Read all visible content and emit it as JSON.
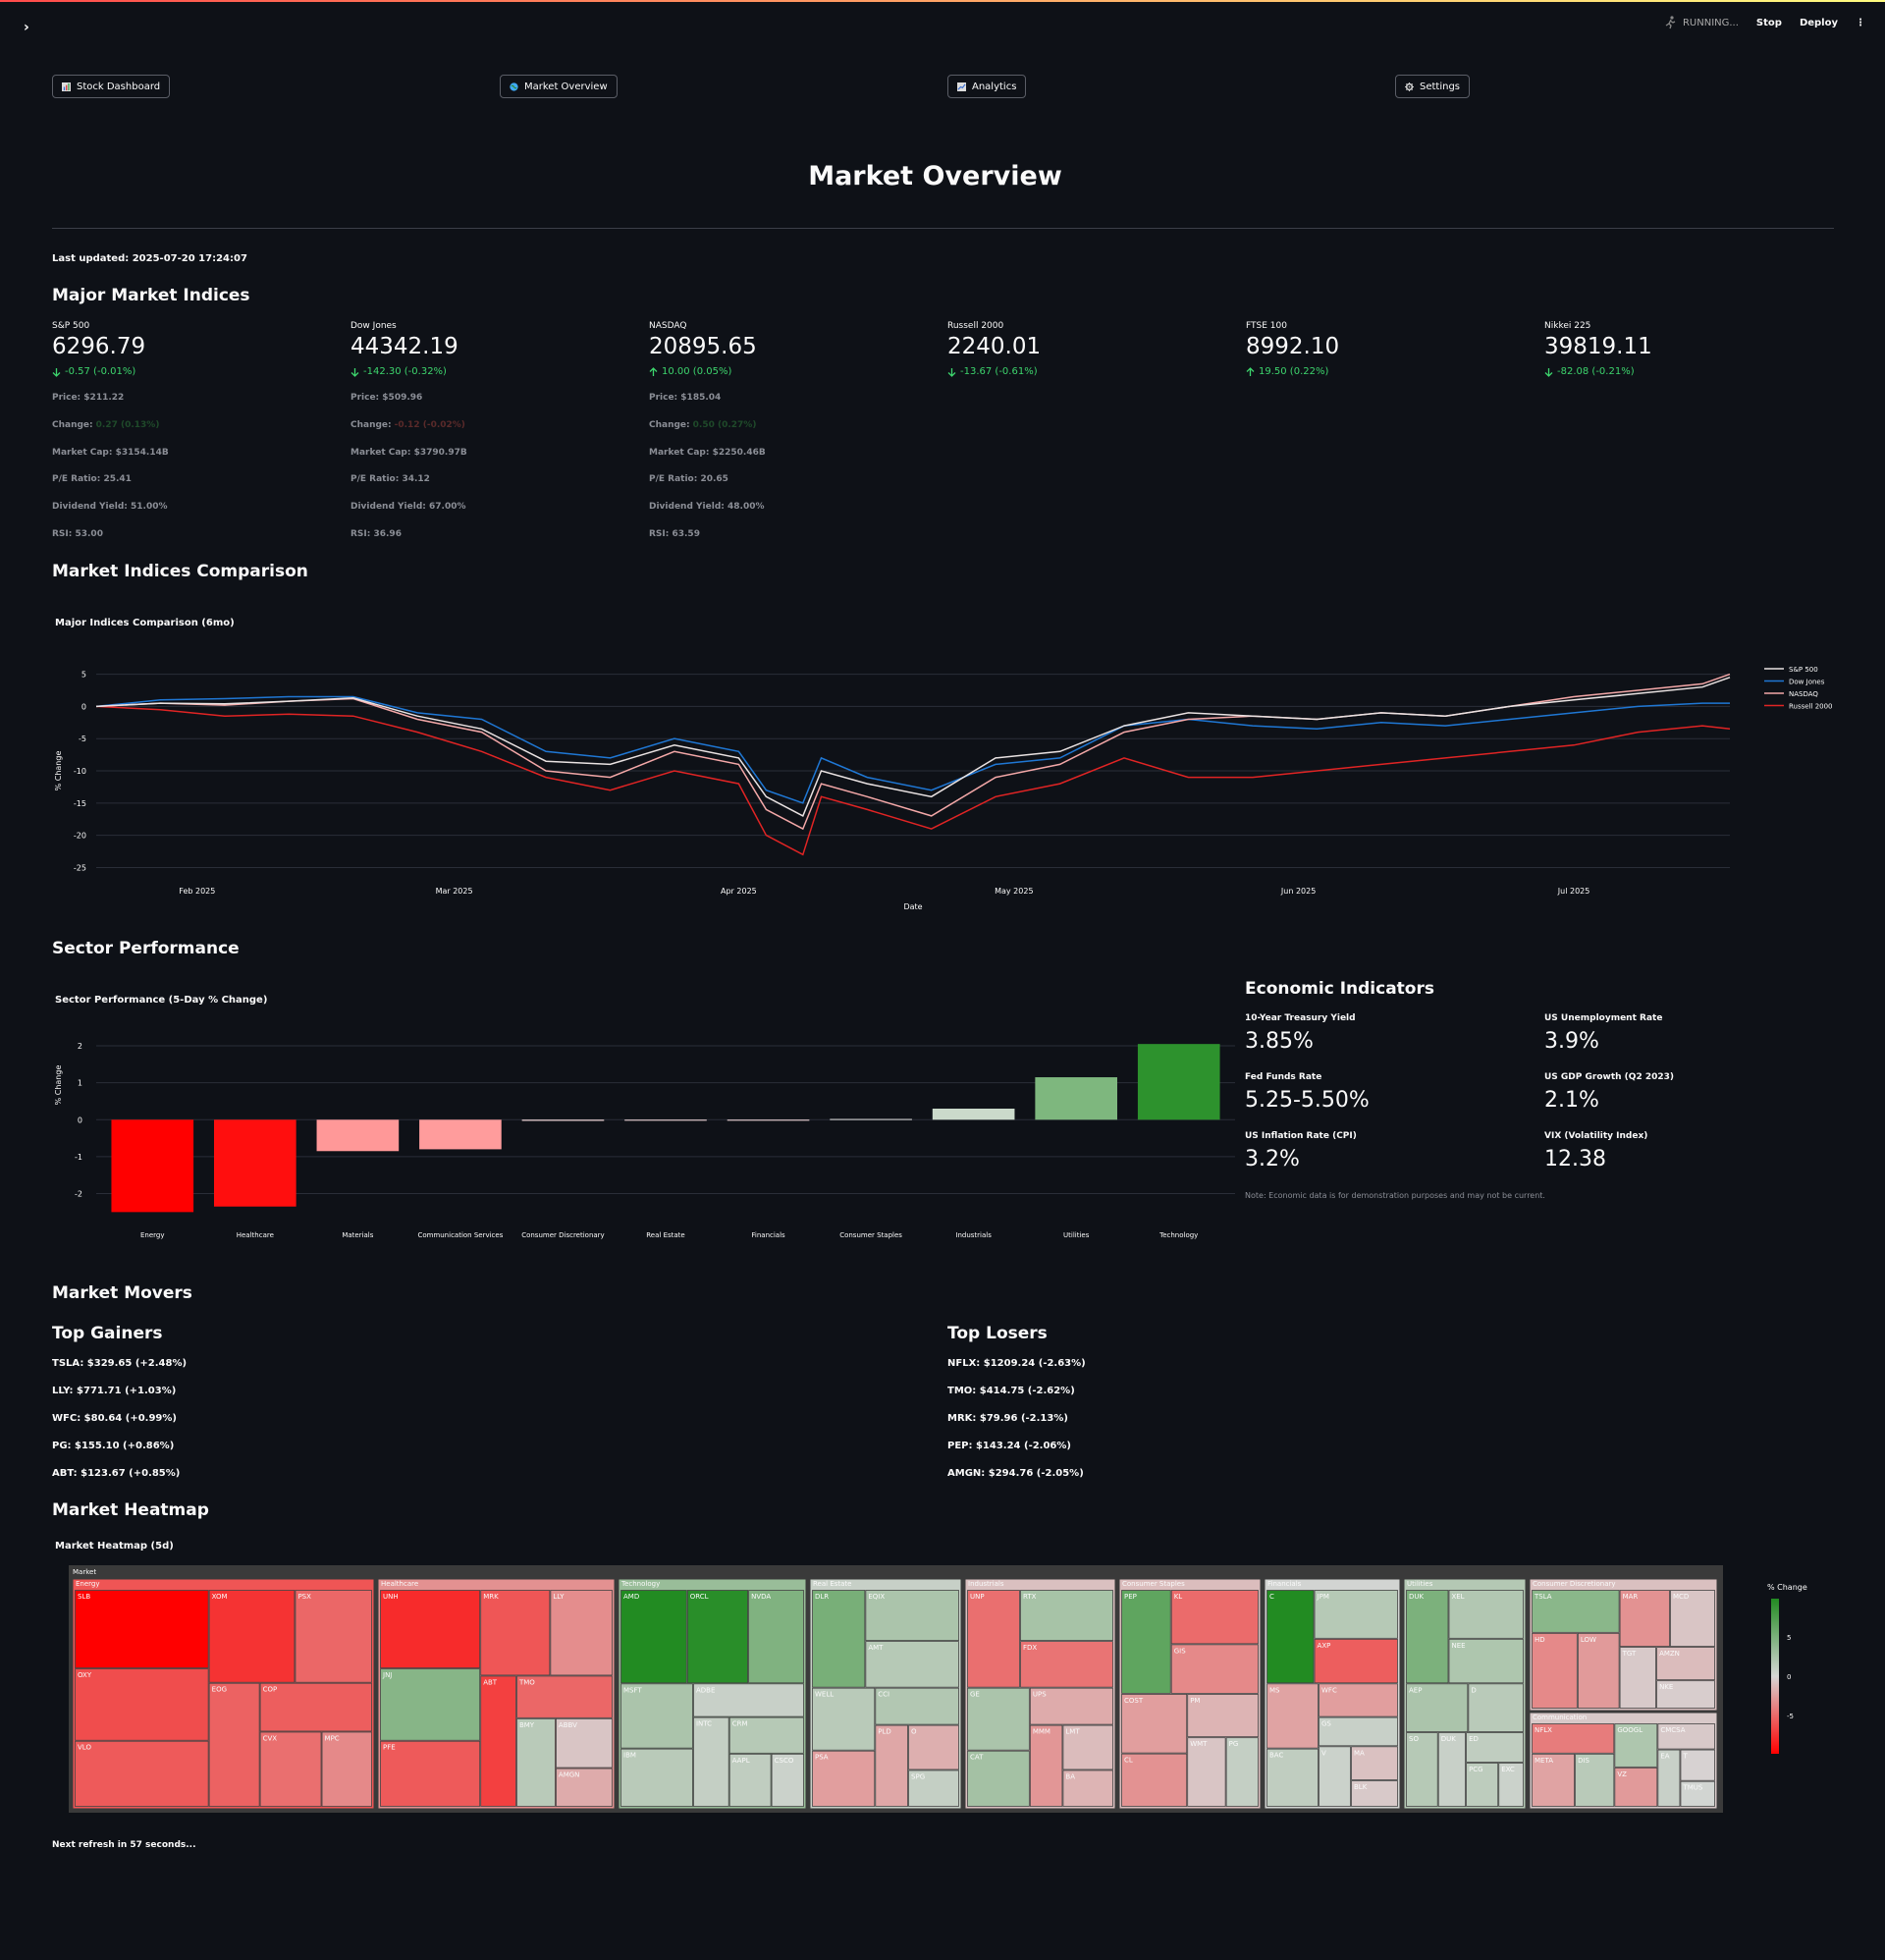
{
  "app": {
    "status": "RUNNING...",
    "stop_label": "Stop",
    "deploy_label": "Deploy",
    "sidebar_toggle": "›",
    "menu_icon": "⋮"
  },
  "nav": {
    "items": [
      {
        "label": "Stock Dashboard",
        "icon": "chart-icon"
      },
      {
        "label": "Market Overview",
        "icon": "globe-icon"
      },
      {
        "label": "Analytics",
        "icon": "trend-icon"
      },
      {
        "label": "Settings",
        "icon": "gear-icon"
      }
    ]
  },
  "page": {
    "title": "Market Overview",
    "last_updated": "Last updated: 2025-07-20 17:24:07",
    "refresh_note": "Next refresh in 57 seconds..."
  },
  "indices": {
    "heading": "Major Market Indices",
    "items": [
      {
        "name": "S&P 500",
        "value": "6296.79",
        "delta": "-0.57 (-0.01%)",
        "direction": "down",
        "price": "Price: $211.22",
        "change_label": "Change:",
        "change": "0.27 (0.13%)",
        "change_color": "green",
        "market_cap": "Market Cap: $3154.14B",
        "pe": "P/E Ratio: 25.41",
        "div": "Dividend Yield: 51.00%",
        "rsi": "RSI: 53.00"
      },
      {
        "name": "Dow Jones",
        "value": "44342.19",
        "delta": "-142.30 (-0.32%)",
        "direction": "down",
        "price": "Price: $509.96",
        "change_label": "Change:",
        "change": "-0.12 (-0.02%)",
        "change_color": "red",
        "market_cap": "Market Cap: $3790.97B",
        "pe": "P/E Ratio: 34.12",
        "div": "Dividend Yield: 67.00%",
        "rsi": "RSI: 36.96"
      },
      {
        "name": "NASDAQ",
        "value": "20895.65",
        "delta": "10.00 (0.05%)",
        "direction": "up",
        "price": "Price: $185.04",
        "change_label": "Change:",
        "change": "0.50 (0.27%)",
        "change_color": "green",
        "market_cap": "Market Cap: $2250.46B",
        "pe": "P/E Ratio: 20.65",
        "div": "Dividend Yield: 48.00%",
        "rsi": "RSI: 63.59"
      },
      {
        "name": "Russell 2000",
        "value": "2240.01",
        "delta": "-13.67 (-0.61%)",
        "direction": "down"
      },
      {
        "name": "FTSE 100",
        "value": "8992.10",
        "delta": "19.50 (0.22%)",
        "direction": "up"
      },
      {
        "name": "Nikkei 225",
        "value": "39819.11",
        "delta": "-82.08 (-0.21%)",
        "direction": "down"
      }
    ]
  },
  "comparison": {
    "heading": "Market Indices Comparison",
    "chart_title": "Major Indices Comparison (6mo)"
  },
  "sector": {
    "heading": "Sector Performance",
    "chart_title": "Sector Performance (5-Day % Change)"
  },
  "economic": {
    "heading": "Economic Indicators",
    "items": [
      {
        "label": "10-Year Treasury Yield",
        "value": "3.85%"
      },
      {
        "label": "US Unemployment Rate",
        "value": "3.9%"
      },
      {
        "label": "Fed Funds Rate",
        "value": "5.25-5.50%"
      },
      {
        "label": "US GDP Growth (Q2 2023)",
        "value": "2.1%"
      },
      {
        "label": "US Inflation Rate (CPI)",
        "value": "3.2%"
      },
      {
        "label": "VIX (Volatility Index)",
        "value": "12.38"
      }
    ],
    "note": "Note: Economic data is for demonstration purposes and may not be current."
  },
  "movers": {
    "heading": "Market Movers",
    "gainers_heading": "Top Gainers",
    "losers_heading": "Top Losers",
    "gainers": [
      "TSLA: $329.65 (+2.48%)",
      "LLY: $771.71 (+1.03%)",
      "WFC: $80.64 (+0.99%)",
      "PG: $155.10 (+0.86%)",
      "ABT: $123.67 (+0.85%)"
    ],
    "losers": [
      "NFLX: $1209.24 (-2.63%)",
      "TMO: $414.75 (-2.62%)",
      "MRK: $79.96 (-2.13%)",
      "PEP: $143.24 (-2.06%)",
      "AMGN: $294.76 (-2.05%)"
    ]
  },
  "heatmap": {
    "heading": "Market Heatmap",
    "chart_title": "Market Heatmap (5d)",
    "root_label": "Market",
    "colorbar_title": "% Change",
    "colorbar_ticks": [
      "5",
      "0",
      "-5"
    ]
  },
  "chart_data": [
    {
      "type": "line",
      "title": "Major Indices Comparison (6mo)",
      "xlabel": "Date",
      "ylabel": "% Change",
      "x_ticks": [
        "Feb 2025",
        "Mar 2025",
        "Apr 2025",
        "May 2025",
        "Jun 2025",
        "Jul 2025"
      ],
      "y_ticks": [
        5,
        0,
        -5,
        -10,
        -15,
        -20,
        -25
      ],
      "ylim": [
        -26,
        6
      ],
      "x": [
        "2025-01-21",
        "2025-01-28",
        "2025-02-04",
        "2025-02-11",
        "2025-02-18",
        "2025-02-25",
        "2025-03-04",
        "2025-03-11",
        "2025-03-18",
        "2025-03-25",
        "2025-04-01",
        "2025-04-04",
        "2025-04-08",
        "2025-04-10",
        "2025-04-15",
        "2025-04-22",
        "2025-04-29",
        "2025-05-06",
        "2025-05-13",
        "2025-05-20",
        "2025-05-27",
        "2025-06-03",
        "2025-06-10",
        "2025-06-17",
        "2025-06-24",
        "2025-07-01",
        "2025-07-08",
        "2025-07-15",
        "2025-07-18"
      ],
      "series": [
        {
          "name": "S&P 500",
          "color": "#e9e2e2",
          "values": [
            0,
            0.5,
            0.4,
            0.8,
            1.3,
            -1.5,
            -3.5,
            -8.5,
            -9,
            -6,
            -8,
            -14,
            -17,
            -10,
            -12,
            -14,
            -8,
            -7,
            -3,
            -1,
            -1.5,
            -2,
            -1,
            -1.5,
            0,
            1,
            2,
            3,
            4.5
          ]
        },
        {
          "name": "Dow Jones",
          "color": "#1f77d4",
          "values": [
            0,
            1,
            1.2,
            1.5,
            1.5,
            -1,
            -2,
            -7,
            -8,
            -5,
            -7,
            -13,
            -15,
            -8,
            -11,
            -13,
            -9,
            -8,
            -3,
            -2,
            -3,
            -3.5,
            -2.5,
            -3,
            -2,
            -1,
            0,
            0.5,
            0.5
          ]
        },
        {
          "name": "NASDAQ",
          "color": "#f4a8a8",
          "values": [
            0,
            0.5,
            0.2,
            0.8,
            1.2,
            -2,
            -4,
            -10,
            -11,
            -7,
            -9,
            -16,
            -19,
            -12,
            -14,
            -17,
            -11,
            -9,
            -4,
            -2,
            -1.5,
            -2,
            -1,
            -1.5,
            0,
            1.5,
            2.5,
            3.5,
            5
          ]
        },
        {
          "name": "Russell 2000",
          "color": "#e02424",
          "values": [
            0,
            -0.5,
            -1.5,
            -1.2,
            -1.5,
            -4,
            -7,
            -11,
            -13,
            -10,
            -12,
            -20,
            -23,
            -14,
            -16,
            -19,
            -14,
            -12,
            -8,
            -11,
            -11,
            -10,
            -9,
            -8,
            -7,
            -6,
            -4,
            -3,
            -3.5
          ]
        }
      ]
    },
    {
      "type": "bar",
      "title": "Sector Performance (5-Day % Change)",
      "ylabel": "% Change",
      "categories": [
        "Energy",
        "Healthcare",
        "Materials",
        "Communication Services",
        "Consumer Discretionary",
        "Real Estate",
        "Financials",
        "Consumer Staples",
        "Industrials",
        "Utilities",
        "Technology"
      ],
      "values": [
        -2.5,
        -2.35,
        -0.85,
        -0.8,
        -0.03,
        -0.02,
        -0.01,
        0.02,
        0.3,
        1.15,
        2.05
      ],
      "y_ticks": [
        2,
        1,
        0,
        -1,
        -2
      ],
      "ylim": [
        -2.7,
        2.4
      ]
    },
    {
      "type": "treemap",
      "title": "Market Heatmap (5d)",
      "colorbar_title": "% Change",
      "sectors": [
        {
          "name": "Energy",
          "tickers": [
            {
              "t": "SLB",
              "c": -5
            },
            {
              "t": "OXY",
              "c": -3.2
            },
            {
              "t": "VLO",
              "c": -2.9
            },
            {
              "t": "XOM",
              "c": -3.8
            },
            {
              "t": "PSX",
              "c": -2.6
            },
            {
              "t": "EOG",
              "c": -2.7
            },
            {
              "t": "COP",
              "c": -2.8
            },
            {
              "t": "CVX",
              "c": -2.4
            },
            {
              "t": "MPC",
              "c": -1.8
            }
          ]
        },
        {
          "name": "Healthcare",
          "tickers": [
            {
              "t": "UNH",
              "c": -4
            },
            {
              "t": "JNJ",
              "c": 2.2
            },
            {
              "t": "PFE",
              "c": -2.9
            },
            {
              "t": "MRK",
              "c": -3.0
            },
            {
              "t": "LLY",
              "c": -1.7
            },
            {
              "t": "ABT",
              "c": -3.5
            },
            {
              "t": "TMO",
              "c": -2.6
            },
            {
              "t": "BMY",
              "c": 0.8
            },
            {
              "t": "ABBV",
              "c": -0.4
            },
            {
              "t": "AMGN",
              "c": -1
            }
          ]
        },
        {
          "name": "Technology",
          "tickers": [
            {
              "t": "AMD",
              "c": 5
            },
            {
              "t": "ORCL",
              "c": 4.8
            },
            {
              "t": "NVDA",
              "c": 2.4
            },
            {
              "t": "MSFT",
              "c": 1.2
            },
            {
              "t": "IBM",
              "c": 0.8
            },
            {
              "t": "ADBE",
              "c": 0.4
            },
            {
              "t": "INTC",
              "c": 0.5
            },
            {
              "t": "CRM",
              "c": 0.9
            },
            {
              "t": "AAPL",
              "c": 0.6
            },
            {
              "t": "CSCO",
              "c": 0.3
            }
          ]
        },
        {
          "name": "Real Estate",
          "tickers": [
            {
              "t": "DLR",
              "c": 2.6
            },
            {
              "t": "EQIX",
              "c": 1.2
            },
            {
              "t": "AMT",
              "c": 0.9
            },
            {
              "t": "WELL",
              "c": 0.8
            },
            {
              "t": "PSA",
              "c": -1.3
            },
            {
              "t": "CCI",
              "c": 1
            },
            {
              "t": "PLD",
              "c": -1.1
            },
            {
              "t": "O",
              "c": -0.9
            },
            {
              "t": "SPG",
              "c": 0.5
            }
          ]
        },
        {
          "name": "Industrials",
          "tickers": [
            {
              "t": "UNP",
              "c": -2.4
            },
            {
              "t": "RTX",
              "c": 1.3
            },
            {
              "t": "FDX",
              "c": -2.3
            },
            {
              "t": "GE",
              "c": 1.2
            },
            {
              "t": "CAT",
              "c": 1.4
            },
            {
              "t": "UPS",
              "c": -1
            },
            {
              "t": "MMM",
              "c": -1.5
            },
            {
              "t": "LMT",
              "c": -0.6
            },
            {
              "t": "BA",
              "c": -0.8
            }
          ]
        },
        {
          "name": "Consumer Staples",
          "tickers": [
            {
              "t": "PEP",
              "c": 3.3
            },
            {
              "t": "KL",
              "c": -2.5
            },
            {
              "t": "GIS",
              "c": -1.8
            },
            {
              "t": "COST",
              "c": -1.3
            },
            {
              "t": "CL",
              "c": -1.6
            },
            {
              "t": "PM",
              "c": -0.8
            },
            {
              "t": "WMT",
              "c": -0.4
            },
            {
              "t": "PG",
              "c": 0.5
            }
          ]
        },
        {
          "name": "Financials",
          "tickers": [
            {
              "t": "C",
              "c": 5
            },
            {
              "t": "JPM",
              "c": 0.9
            },
            {
              "t": "AXP",
              "c": -2.8
            },
            {
              "t": "MS",
              "c": -1.2
            },
            {
              "t": "BAC",
              "c": 0.6
            },
            {
              "t": "WFC",
              "c": -1.3
            },
            {
              "t": "GS",
              "c": 0.4
            },
            {
              "t": "V",
              "c": 0.3
            },
            {
              "t": "MA",
              "c": -0.5
            },
            {
              "t": "BLK",
              "c": -0.3
            }
          ]
        },
        {
          "name": "Utilities",
          "tickers": [
            {
              "t": "DUK",
              "c": 2.5
            },
            {
              "t": "XEL",
              "c": 1.0
            },
            {
              "t": "NEE",
              "c": 1.1
            },
            {
              "t": "AEP",
              "c": 1.2
            },
            {
              "t": "D",
              "c": 0.8
            },
            {
              "t": "SO",
              "c": 0.9
            },
            {
              "t": "DUK",
              "c": 0.4
            },
            {
              "t": "ED",
              "c": 0.6
            },
            {
              "t": "PCG",
              "c": 0.7
            },
            {
              "t": "EXC",
              "c": 0.3
            }
          ]
        },
        {
          "name": "Consumer Discretionary",
          "tickers": [
            {
              "t": "TSLA",
              "c": 2.1
            },
            {
              "t": "HD",
              "c": -1.8
            },
            {
              "t": "LOW",
              "c": -1.4
            },
            {
              "t": "MAR",
              "c": -1.6
            },
            {
              "t": "MCD",
              "c": -0.4
            },
            {
              "t": "TGT",
              "c": -0.3
            },
            {
              "t": "AMZN",
              "c": -0.6
            },
            {
              "t": "NKE",
              "c": -0.2
            }
          ]
        },
        {
          "name": "Communication",
          "tickers": [
            {
              "t": "NFLX",
              "c": -2.1
            },
            {
              "t": "META",
              "c": -1.2
            },
            {
              "t": "DIS",
              "c": 0.8
            },
            {
              "t": "GOOGL",
              "c": 1.1
            },
            {
              "t": "VZ",
              "c": -1.4
            },
            {
              "t": "CMCSA",
              "c": -0.3
            },
            {
              "t": "EA",
              "c": 0.4
            },
            {
              "t": "T",
              "c": -0.1
            },
            {
              "t": "TMUS",
              "c": 0.1
            }
          ]
        }
      ]
    }
  ]
}
